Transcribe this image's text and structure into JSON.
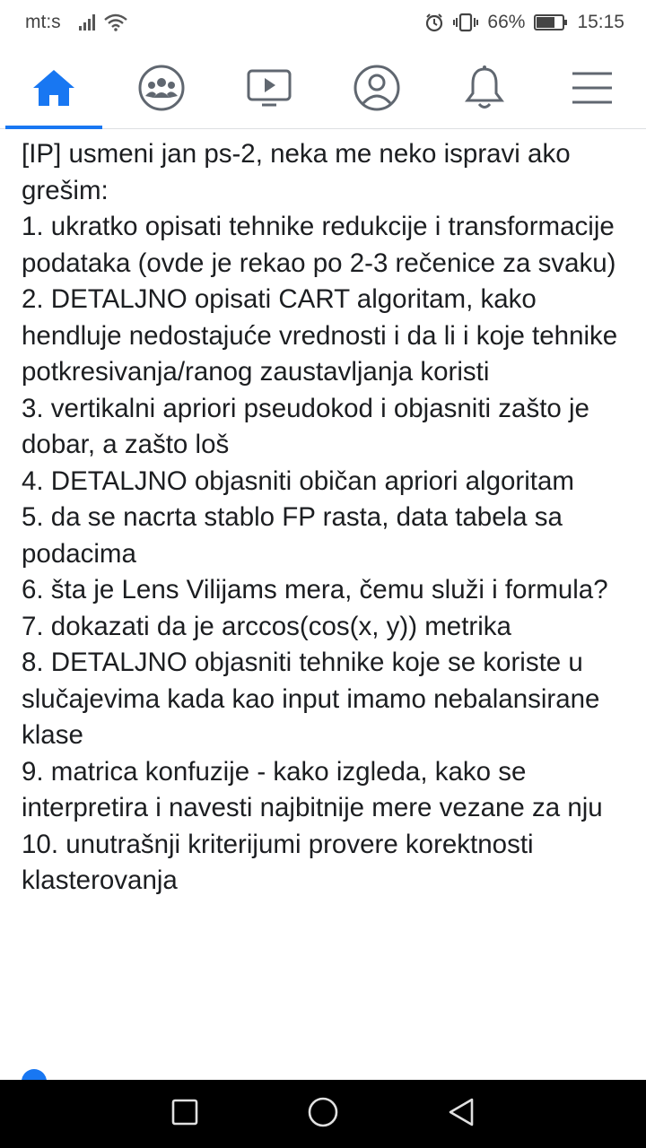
{
  "status_bar": {
    "carrier": "mt:s",
    "battery": "66%",
    "time": "15:15"
  },
  "tabs": [
    {
      "name": "home",
      "icon": "home-icon",
      "active": true
    },
    {
      "name": "groups",
      "icon": "groups-icon",
      "active": false
    },
    {
      "name": "watch",
      "icon": "video-icon",
      "active": false
    },
    {
      "name": "profile",
      "icon": "profile-icon",
      "active": false
    },
    {
      "name": "notifications",
      "icon": "bell-icon",
      "active": false
    },
    {
      "name": "menu",
      "icon": "hamburger-menu-icon",
      "active": false
    }
  ],
  "colors": {
    "accent": "#1877f2",
    "icon": "#606770",
    "text": "#1c1e21"
  },
  "post": {
    "intro": "[IP] usmeni jan ps-2, neka me neko ispravi ako grešim:",
    "items": [
      "1. ukratko opisati tehnike redukcije i transformacije podataka (ovde je rekao po 2-3 rečenice za svaku)",
      "2. DETALJNO opisati CART algoritam, kako hendluje nedostajuće vrednosti i da li i koje tehnike potkresivanja/ranog zaustavljanja koristi",
      "3. vertikalni apriori pseudokod i objasniti zašto je dobar, a zašto loš",
      "4. DETALJNO objasniti običan apriori algoritam",
      "5. da se nacrta stablo FP rasta, data tabela sa podacima",
      "6. šta je Lens Vilijams mera, čemu služi i formula?",
      "7. dokazati da je arccos(cos(x, y)) metrika",
      "8. DETALJNO objasniti tehnike koje se koriste u slučajevima kada kao input imamo nebalansirane klase",
      "9. matrica konfuzije - kako izgleda, kako se interpretira i navesti najbitnije mere vezane za nju",
      "10. unutrašnji kriterijumi provere korektnosti klasterovanja"
    ]
  },
  "nav_bar": {
    "buttons": [
      "recent-apps-icon",
      "home-circle-icon",
      "back-triangle-icon"
    ]
  }
}
